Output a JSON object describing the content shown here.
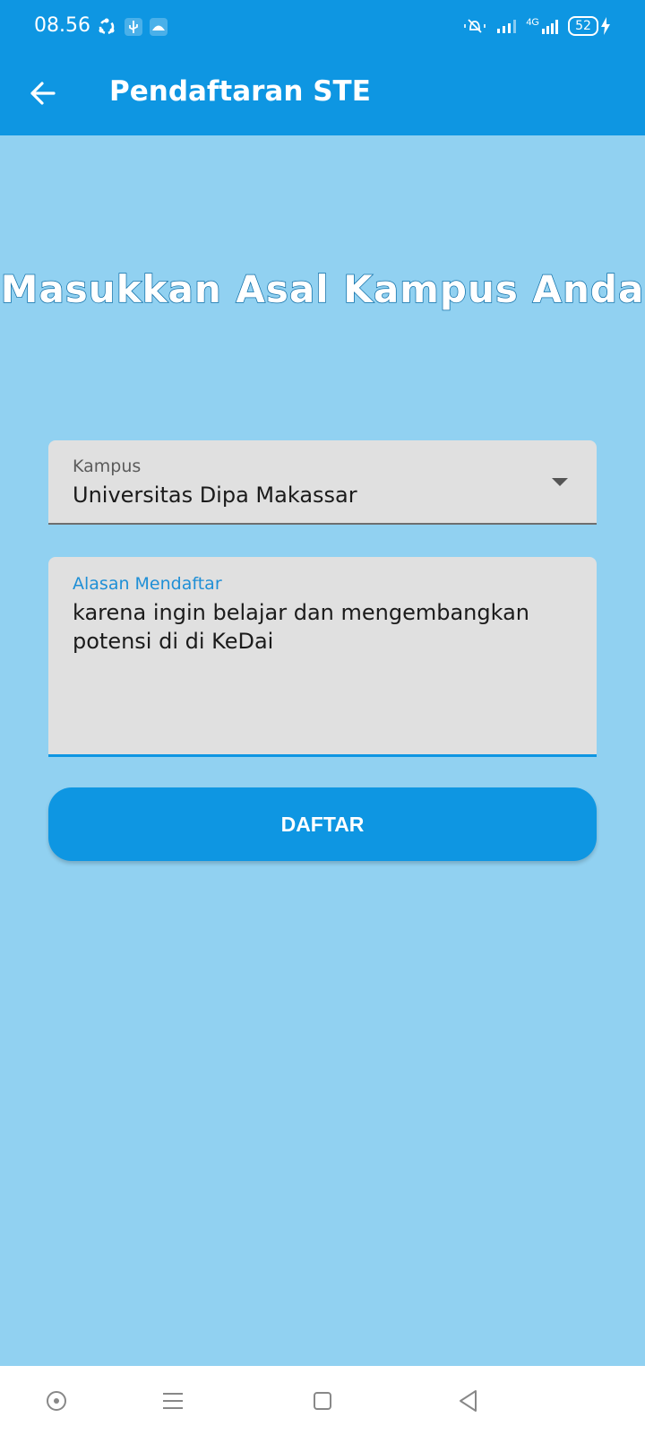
{
  "status_bar": {
    "time": "08.56",
    "network": "4G",
    "battery_percent": "52"
  },
  "app_bar": {
    "title": "Pendaftaran STE"
  },
  "page": {
    "heading": "Masukkan Asal Kampus Anda"
  },
  "form": {
    "campus": {
      "label": "Kampus",
      "value": "Universitas Dipa Makassar"
    },
    "reason": {
      "label": "Alasan Mendaftar",
      "value": "karena ingin belajar dan mengembangkan potensi di di KeDai"
    },
    "submit_label": "DAFTAR"
  },
  "colors": {
    "primary": "#0e96e2",
    "background": "#91d1f1",
    "field": "#e0e0e0"
  }
}
